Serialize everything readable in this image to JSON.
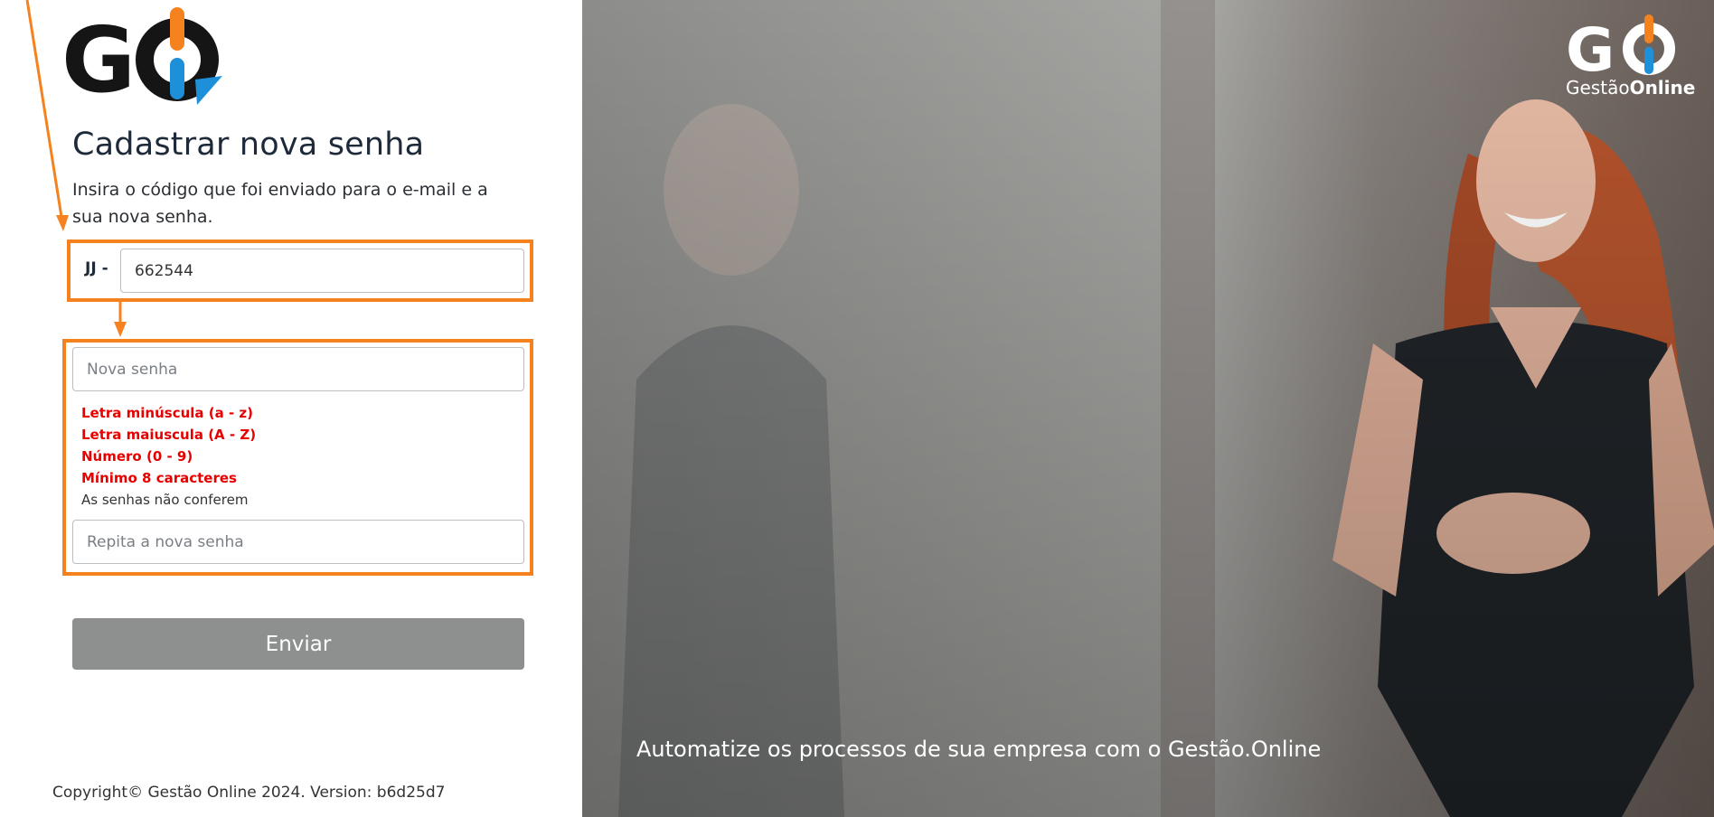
{
  "page": {
    "title": "Cadastrar nova senha",
    "subtitle": "Insira o código que foi enviado para o e-mail e a sua nova senha."
  },
  "code_field": {
    "prefix": "JJ -",
    "value": "662544"
  },
  "password_field": {
    "placeholder": "Nova senha"
  },
  "password_rules": [
    "Letra minúscula (a - z)",
    "Letra maiuscula (A - Z)",
    "Número (0 - 9)",
    "Mínimo 8 caracteres"
  ],
  "password_mismatch": "As senhas não conferem",
  "repeat_field": {
    "placeholder": "Repita a nova senha"
  },
  "submit_label": "Enviar",
  "copyright": "Copyright© Gestão Online 2024. Version: b6d25d7",
  "hero": {
    "caption": "Automatize os processos de sua empresa com o Gestão.Online",
    "brand_light": "Gestão",
    "brand_bold": "Online"
  },
  "colors": {
    "accent_orange": "#f5821f",
    "accent_blue": "#1e90d9",
    "error_red": "#e60000",
    "button_disabled": "#8e9090"
  }
}
